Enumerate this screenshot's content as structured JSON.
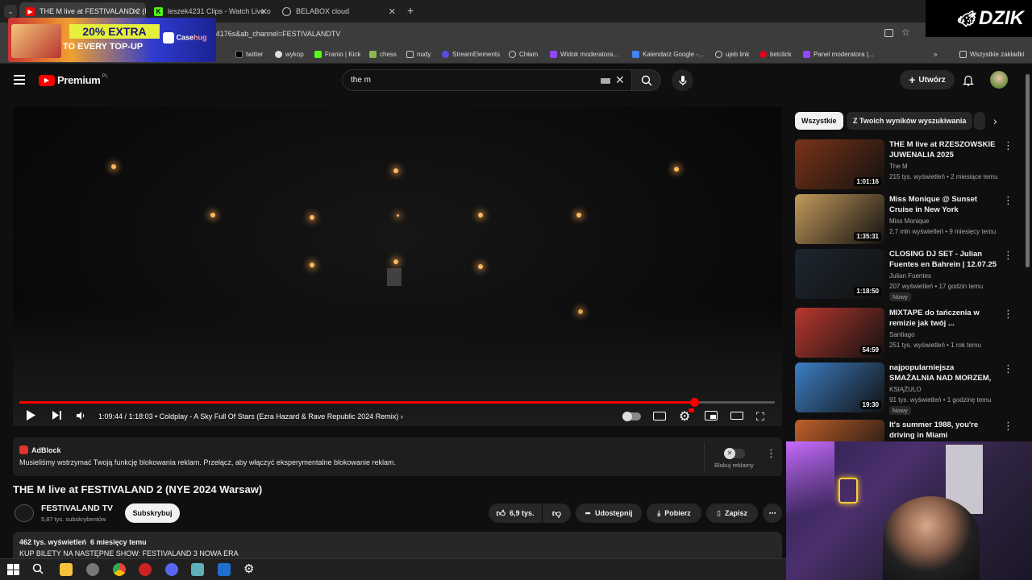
{
  "browser": {
    "tabs": [
      {
        "title": "THE M live at FESTIVALAND 2 (N",
        "icon": "youtube-icon",
        "active": true
      },
      {
        "title": "leszek4231 Clips - Watch Live o",
        "icon": "kick-icon",
        "active": false
      },
      {
        "title": "BELABOX cloud",
        "icon": "globe-icon",
        "active": false
      }
    ],
    "address": "t=4176s&ab_channel=FESTIVALANDTV",
    "bookmarks": [
      "twitter",
      "wykop",
      "Franio | Kick",
      "chess",
      "nudy",
      "StreamElements",
      "Chłam",
      "Widok moderatora...",
      "Kalendarz Google -...",
      "ujeb link",
      "betclick",
      "Panel moderatora |..."
    ],
    "all_bookmarks": "Wszystkie zakładki"
  },
  "youtube": {
    "logo": "Premium",
    "logo_region": "PL",
    "search_value": "the m",
    "create_label": "Utwórz",
    "player": {
      "current_time": "1:09:44",
      "duration": "1:18:03",
      "time_sep": "/",
      "chapter": "Coldplay - A Sky Full Of Stars (Ezra Hazard & Rave Republic 2024 Remix)",
      "progress_fraction": 0.893
    },
    "adblock": {
      "brand": "AdBlock",
      "message": "Musieliśmy wstrzymać Twoją funkcję blokowania reklam. Przełącz, aby włączyć eksperymentalne blokowanie reklam.",
      "toggle_label": "Blokuj reklamy"
    },
    "video_title": "THE M live at FESTIVALAND 2 (NYE 2024 Warsaw)",
    "channel": {
      "name": "FESTIVALAND TV",
      "subs": "5,87 tys. subskrybentów",
      "subscribe": "Subskrybuj"
    },
    "actions": {
      "likes": "6,9 tys.",
      "share": "Udostępnij",
      "download": "Pobierz",
      "save": "Zapisz"
    },
    "description": {
      "stats": "462 tys. wyświetleń  6 miesięcy temu",
      "line": "KUP BILETY NA NASTĘPNE SHOW: FESTIVALAND 3 NOWA ERA"
    },
    "chips": [
      "Wszystkie",
      "Z Twoich wyników wyszukiwania"
    ],
    "recommended": [
      {
        "title": "THE M live at RZESZOWSKIE JUWENALIA 2025",
        "channel": "The M",
        "meta": "215 tys. wyświetleń • 2 miesiące temu",
        "duration": "1:01:16",
        "badge": "",
        "color": "#7a3418"
      },
      {
        "title": "Miss Monique @ Sunset Cruise in New York [Progressive hous...",
        "channel": "Miss Monique",
        "meta": "2,7 mln wyświetleń • 9 miesięcy temu",
        "duration": "1:35:31",
        "badge": "",
        "color": "#c49a5a"
      },
      {
        "title": "CLOSING DJ SET - Julian Fuentes en Bahrein | 12.07.25",
        "channel": "Julian Fuentes",
        "meta": "207 wyświetleń • 17 godzin temu",
        "duration": "1:18:50",
        "badge": "Nowy",
        "color": "#1d2630"
      },
      {
        "title": "MIXTAPE do tańczenia w remizie jak twój ...",
        "channel": "Santiago",
        "meta": "251 tys. wyświetleń • 1 rok temu",
        "duration": "54:59",
        "badge": "",
        "color": "#b8382e"
      },
      {
        "title": "najpopularniejsza SMAŻALNIA NAD MORZEM, dlaczego ludzi...",
        "channel": "KSIĄŻULO",
        "meta": "91 tys. wyświetleń • 1 godzinę temu",
        "duration": "19:30",
        "badge": "Nowy",
        "color": "#3c7fc4"
      },
      {
        "title": "It's summer 1988, you're driving in Miami",
        "channel": "",
        "meta": "",
        "duration": "",
        "badge": "",
        "color": "#c0602a"
      }
    ]
  },
  "overlay": {
    "promo_text1": "20% EXTRA",
    "promo_text2": "TO EVERY TOP-UP",
    "promo_brand": "Case",
    "promo_brand2": "hug",
    "logo": "DZIK"
  }
}
